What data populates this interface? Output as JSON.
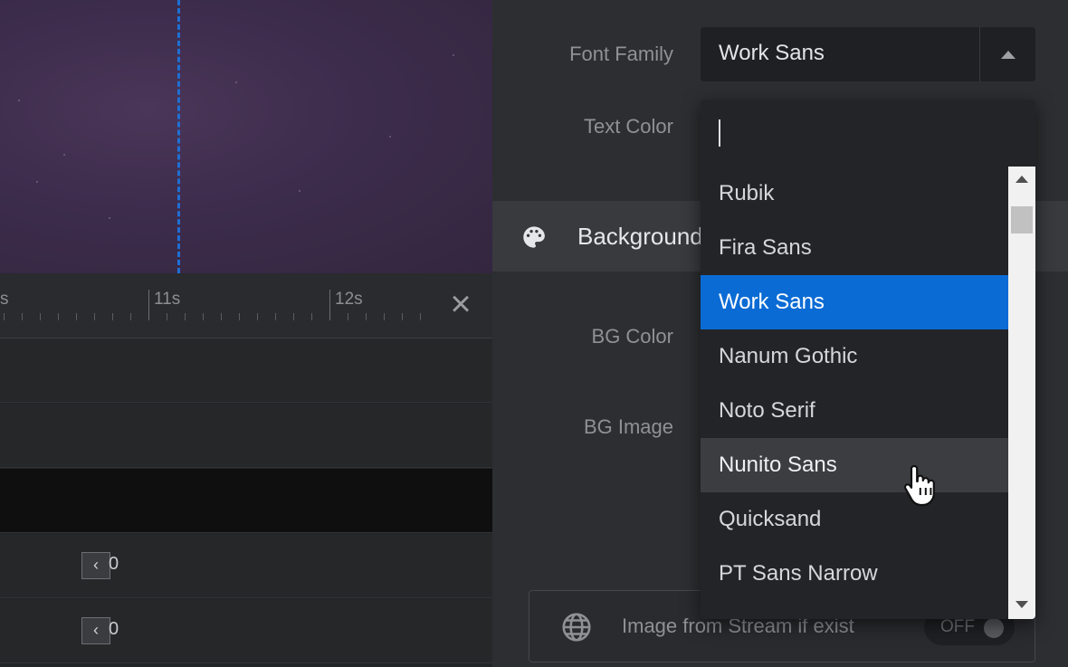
{
  "timeline": {
    "ruler_labels": [
      "s",
      "11s",
      "12s"
    ],
    "keyframe_value": "0"
  },
  "panel": {
    "font_family_label": "Font Family",
    "font_family_value": "Work Sans",
    "text_color_label": "Text Color",
    "background_section_title": "Background",
    "bg_color_label": "BG Color",
    "bg_image_label": "BG Image",
    "stream_label": "Image from Stream if exist",
    "stream_toggle": "OFF"
  },
  "dropdown": {
    "search_value": "",
    "options": [
      "Rubik",
      "Fira Sans",
      "Work Sans",
      "Nanum Gothic",
      "Noto Serif",
      "Nunito Sans",
      "Quicksand",
      "PT Sans Narrow"
    ],
    "selected": "Work Sans",
    "hovered": "Nunito Sans"
  },
  "colors": {
    "accent": "#0a6bd4",
    "playhead": "#1f6fd6",
    "canvas_bg": "#3d2c4c"
  }
}
